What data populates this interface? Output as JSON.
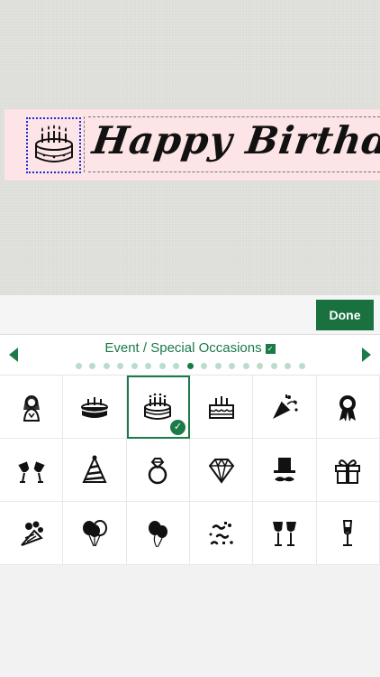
{
  "label": {
    "text": "Happy Birthday!",
    "strip_color": "#fde4e6",
    "selection_color": "#1a2fd6"
  },
  "toolbar": {
    "done_label": "Done",
    "accent": "#1a7140"
  },
  "category": {
    "title": "Event / Special Occasions",
    "dropdown_glyph": "✓",
    "page_count": 17,
    "active_page": 8
  },
  "icons": [
    {
      "name": "bride-icon"
    },
    {
      "name": "cake-icon"
    },
    {
      "name": "birthday-cake-candles-icon",
      "selected": true
    },
    {
      "name": "layer-cake-icon"
    },
    {
      "name": "party-popper-icon"
    },
    {
      "name": "award-ribbon-icon"
    },
    {
      "name": "cheers-glasses-icon"
    },
    {
      "name": "party-hat-icon"
    },
    {
      "name": "diamond-ring-icon"
    },
    {
      "name": "diamond-icon"
    },
    {
      "name": "top-hat-mustache-icon"
    },
    {
      "name": "gift-box-icon"
    },
    {
      "name": "flower-bouquet-icon"
    },
    {
      "name": "balloons-icon"
    },
    {
      "name": "balloon-pair-icon"
    },
    {
      "name": "confetti-icon"
    },
    {
      "name": "wine-glasses-icon"
    },
    {
      "name": "champagne-flute-icon"
    }
  ],
  "selected_check": "✓"
}
